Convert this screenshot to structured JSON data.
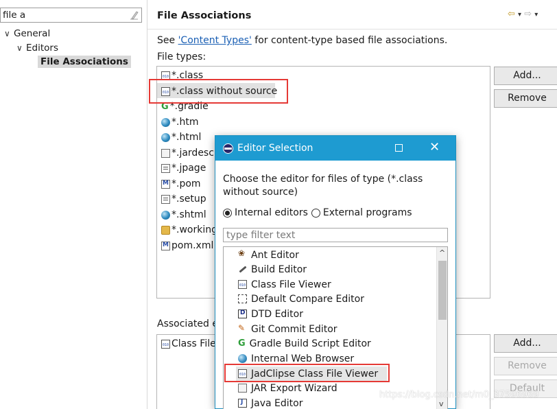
{
  "left": {
    "filter_value": "file a",
    "tree": [
      {
        "label": "General",
        "chevron": "∨"
      },
      {
        "label": "Editors",
        "chevron": "∨"
      },
      {
        "label": "File Associations"
      }
    ]
  },
  "header": {
    "title": "File Associations",
    "nav_back": "⇦",
    "nav_down1": "▾",
    "nav_forward": "⇨",
    "nav_down2": "▾"
  },
  "desc": {
    "prefix": "See ",
    "link": "'Content Types'",
    "suffix": " for content-type based file associations."
  },
  "file_types": {
    "label": "File types:",
    "items": [
      {
        "text": "*.class",
        "icon": "class-file-icon"
      },
      {
        "text": "*.class without source",
        "icon": "class-file-icon"
      },
      {
        "text": "*.gradle",
        "icon": "gradle-icon"
      },
      {
        "text": "*.htm",
        "icon": "globe-icon"
      },
      {
        "text": "*.html",
        "icon": "globe-icon"
      },
      {
        "text": "*.jardesc",
        "icon": "jar-icon"
      },
      {
        "text": "*.jpage",
        "icon": "file-icon"
      },
      {
        "text": "*.pom",
        "icon": "maven-icon"
      },
      {
        "text": "*.setup",
        "icon": "file-icon"
      },
      {
        "text": "*.shtml",
        "icon": "globe-icon"
      },
      {
        "text": "*.working",
        "icon": "folder-icon"
      },
      {
        "text": "pom.xml",
        "icon": "maven-icon"
      }
    ],
    "add": "Add...",
    "remove": "Remove"
  },
  "associated": {
    "label": "Associated e",
    "items": [
      {
        "text": "Class File",
        "icon": "class-file-icon"
      }
    ],
    "add": "Add...",
    "remove": "Remove",
    "default": "Default"
  },
  "dialog": {
    "title": "Editor Selection",
    "prompt": "Choose the editor for files of type (*.class without source)",
    "internal": "Internal editors",
    "external": "External programs",
    "filter_placeholder": "type filter text",
    "editors": [
      {
        "label": "Ant Editor",
        "icon": "ant-icon"
      },
      {
        "label": "Build Editor",
        "icon": "wrench-icon"
      },
      {
        "label": "Class File Viewer",
        "icon": "class-file-icon"
      },
      {
        "label": "Default Compare Editor",
        "icon": "compare-icon"
      },
      {
        "label": "DTD Editor",
        "icon": "dtd-icon"
      },
      {
        "label": "Git Commit Editor",
        "icon": "git-icon"
      },
      {
        "label": "Gradle Build Script Editor",
        "icon": "gradle-icon"
      },
      {
        "label": "Internal Web Browser",
        "icon": "globe-icon"
      },
      {
        "label": "JadClipse Class File Viewer",
        "icon": "class-file-icon"
      },
      {
        "label": "JAR Export Wizard",
        "icon": "jar-icon"
      },
      {
        "label": "Java Editor",
        "icon": "java-icon"
      }
    ],
    "selected": "JadClipse Class File Viewer"
  },
  "watermark": "https://blog.csdn.net/m0_37596969",
  "colors": {
    "titlebar": "#1e9bd1",
    "highlight": "#e53935",
    "link": "#1a5fb4"
  }
}
